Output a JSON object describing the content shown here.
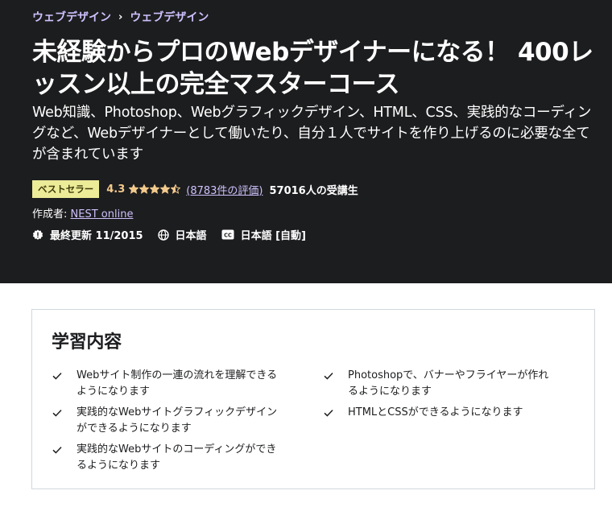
{
  "breadcrumb": {
    "items": [
      "ウェブデザイン",
      "ウェブデザイン"
    ],
    "separator": "›"
  },
  "course": {
    "title": "未経験からプロのWebデザイナーになる！ 400レッスン以上の完全マスターコース",
    "subtitle": "Web知識、Photoshop、Webグラフィックデザイン、HTML、CSS、実践的なコーディングなど、Webデザイナーとして働いたり、自分１人でサイトを作り上げるのに必要な全てが含まれています",
    "badge": "ベストセラー",
    "rating": "4.3",
    "rating_value": 4.3,
    "rating_max": 5,
    "ratings_count": "(8783件の評価)",
    "students": "57016人の受講生",
    "creator_label": "作成者:",
    "creator_name": "NEST online",
    "last_updated": "最終更新 11/2015",
    "language": "日本語",
    "captions": "日本語 [自動]"
  },
  "learn": {
    "title": "学習内容",
    "left": [
      "Webサイト制作の一連の流れを理解できるようになります",
      "実践的なWebサイトグラフィックデザインができるようになります",
      "実践的なWebサイトのコーディングができるようになります"
    ],
    "right": [
      "Photoshopで、バナーやフライヤーが作れるようになります",
      "HTMLとCSSができるようになります"
    ]
  },
  "colors": {
    "hero_bg": "#1c1d1f",
    "link": "#cec0fc",
    "badge_bg": "#eceb98",
    "star": "#f3ca8c"
  },
  "icons": {
    "breadcrumb_sep": "chevron-right-icon",
    "updated": "alert-badge-icon",
    "language": "globe-icon",
    "captions": "closed-captions-icon",
    "check": "check-icon",
    "star": "star-icon"
  }
}
